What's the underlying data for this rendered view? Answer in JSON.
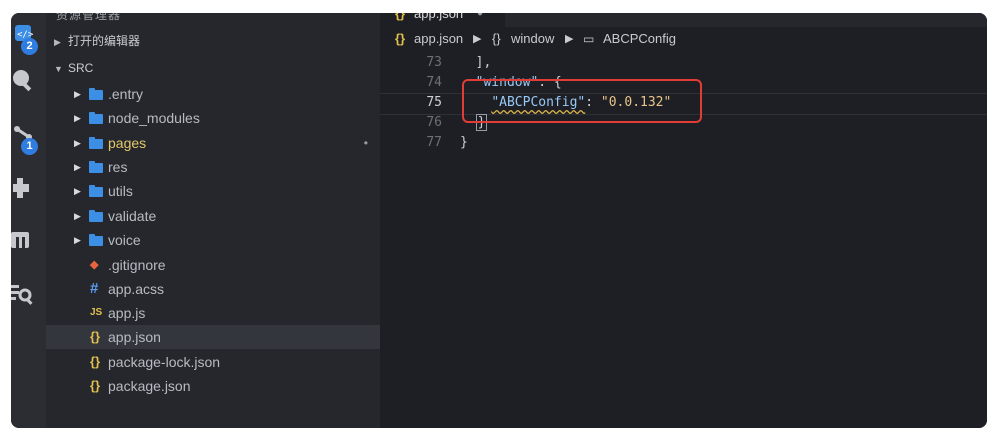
{
  "activity_bar": {
    "explorer_badge": "2",
    "scm_badge": "1",
    "icons": [
      "explorer-icon",
      "search-icon",
      "source-control-icon",
      "extensions-icon",
      "pages-icon",
      "search-file-icon"
    ]
  },
  "sidebar": {
    "title": "资源管理器",
    "open_editors_label": "打开的编辑器",
    "folder_label": "SRC",
    "items": [
      {
        "type": "folder",
        "label": ".entry",
        "modified": false
      },
      {
        "type": "folder",
        "label": "node_modules",
        "modified": false
      },
      {
        "type": "folder",
        "label": "pages",
        "modified": true,
        "modified_dot": "•"
      },
      {
        "type": "folder",
        "label": "res",
        "modified": false
      },
      {
        "type": "folder",
        "label": "utils",
        "modified": false
      },
      {
        "type": "folder",
        "label": "validate",
        "modified": false
      },
      {
        "type": "folder",
        "label": "voice",
        "modified": false
      },
      {
        "type": "file",
        "icon": "git",
        "icon_glyph": "◆",
        "label": ".gitignore"
      },
      {
        "type": "file",
        "icon": "css",
        "icon_glyph": "#",
        "label": "app.acss"
      },
      {
        "type": "file",
        "icon": "js",
        "icon_glyph": "JS",
        "label": "app.js"
      },
      {
        "type": "file",
        "icon": "json",
        "icon_glyph": "{}",
        "label": "app.json",
        "selected": true
      },
      {
        "type": "file",
        "icon": "json",
        "icon_glyph": "{}",
        "label": "package-lock.json"
      },
      {
        "type": "file",
        "icon": "json",
        "icon_glyph": "{}",
        "label": "package.json"
      }
    ]
  },
  "editor": {
    "tab": {
      "icon": "{}",
      "label": "app.json",
      "modified_dot": "●"
    },
    "breadcrumb": {
      "file_icon": "{}",
      "file": "app.json",
      "sep": "▶",
      "object_icon": "{}",
      "object": "window",
      "prop_icon": "▭",
      "prop": "ABCPConfig"
    },
    "lines": [
      {
        "num": "73",
        "text": "  ],"
      },
      {
        "num": "74",
        "key": "\"window\"",
        "after": ": {"
      },
      {
        "num": "75",
        "key": "\"ABCPConfig\"",
        "colon": ": ",
        "value": "\"0.0.132\""
      },
      {
        "num": "76",
        "text": "}"
      },
      {
        "num": "77",
        "text": "}"
      }
    ]
  },
  "colors": {
    "accent_blue": "#3d8fe6",
    "highlight_red": "#e23c36",
    "badge_blue": "#2f7de0"
  }
}
